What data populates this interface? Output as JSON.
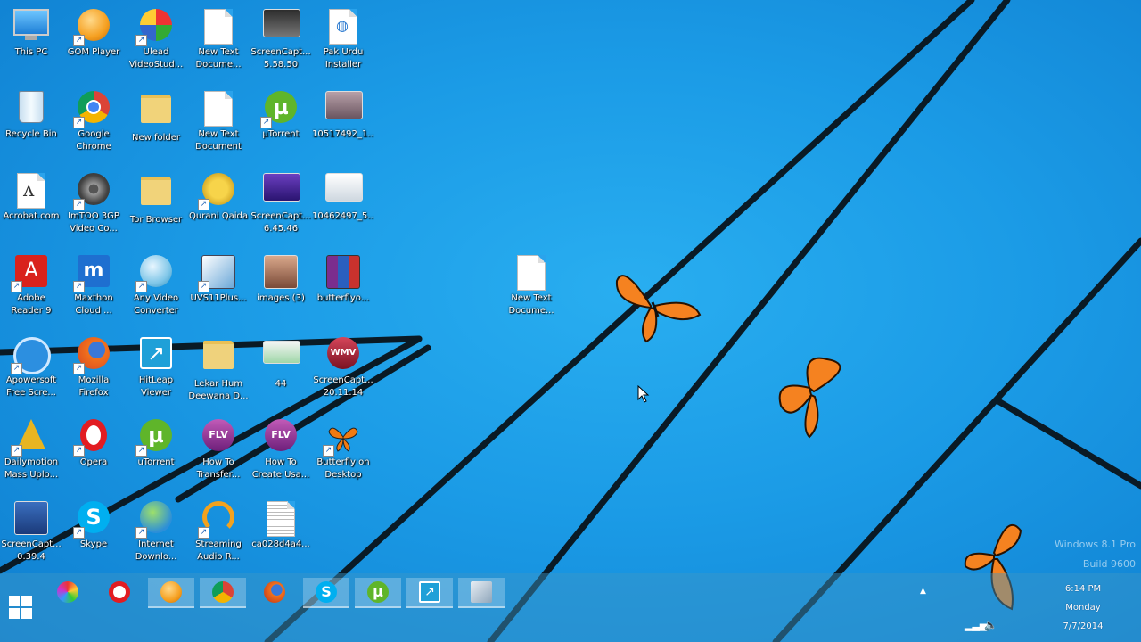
{
  "desktop": {
    "icons_col1": [
      "This PC",
      "Recycle Bin",
      "Acrobat.com",
      "Adobe\nReader 9",
      "Apowersoft\nFree Scre...",
      "Dailymotion\nMass Uplo...",
      "ScreenCapt...\n0.39.4"
    ],
    "icons_col2": [
      "GOM Player",
      "Google\nChrome",
      "ImTOO 3GP\nVideo Co...",
      "Maxthon\nCloud ...",
      "Mozilla\nFirefox",
      "Opera",
      "Skype"
    ],
    "icons_col3": [
      "Ulead\nVideoStud...",
      "New folder",
      "Tor Browser",
      "Any Video\nConverter",
      "HitLeap\nViewer",
      "uTorrent",
      "Internet\nDownlo..."
    ],
    "icons_col4": [
      "New Text\nDocume...",
      "New Text\nDocument",
      "Qurani Qaida",
      "UVS11Plus...",
      "Lekar Hum\nDeewana D...",
      "How To\nTransfer...",
      "Streaming\nAudio R..."
    ],
    "icons_col5": [
      "ScreenCapt...\n5.58.50",
      "μTorrent",
      "ScreenCapt...\n6.45.46",
      "images (3)",
      "44",
      "How To\nCreate Usa...",
      "ca028d4a4..."
    ],
    "icons_col6": [
      "Pak Urdu\nInstaller",
      "10517492_1...",
      "10462497_5...",
      "butterflyo...",
      "ScreenCapt...\n20.11.14",
      "Butterfly on\nDesktop"
    ],
    "floating_icon": "New Text\nDocume..."
  },
  "taskbar": {
    "pinned": [
      "paint-icon",
      "opera-icon",
      "gom-player-icon",
      "chrome-icon",
      "firefox-icon",
      "skype-icon",
      "utorrent-icon",
      "hitleap-icon",
      "app-window-icon"
    ]
  },
  "tray": {
    "time": "6:14 PM",
    "day": "Monday",
    "date": "7/7/2014"
  },
  "watermark": {
    "line1": "Windows 8.1 Pro",
    "line2": "Build 9600"
  }
}
